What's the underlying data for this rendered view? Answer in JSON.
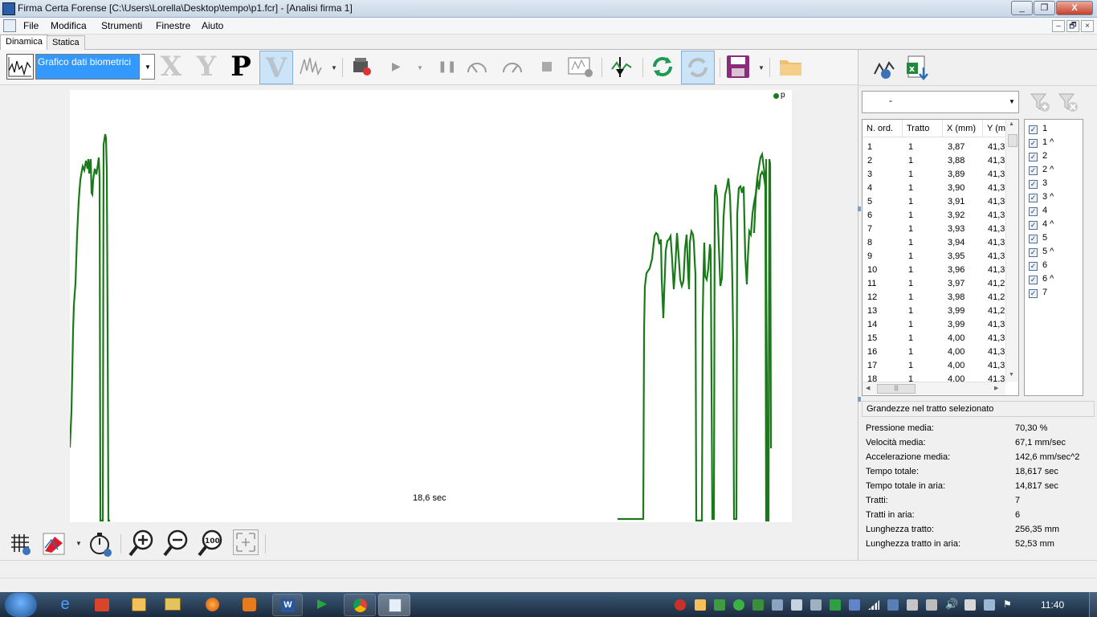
{
  "window": {
    "title": "Firma Certa Forense [C:\\Users\\Lorella\\Desktop\\tempo\\p1.fcr] - [Analisi firma 1]",
    "controls": [
      "_",
      "❐",
      "X"
    ]
  },
  "menu": {
    "items": [
      "File",
      "Modifica",
      "Strumenti",
      "Finestre",
      "Aiuto"
    ],
    "mdi_controls": [
      "–",
      "🗗",
      "×"
    ]
  },
  "tabs": [
    "Dinamica",
    "Statica"
  ],
  "toolbar": {
    "chart_selector_value": "Grafico dati biometrici",
    "letters": [
      "X",
      "Y",
      "P",
      "V"
    ]
  },
  "plot": {
    "legend_label": "p",
    "time_label": "18,6 sec",
    "line_color": "#1a7a1a"
  },
  "filter": {
    "combo_value": "-"
  },
  "grid": {
    "headers": [
      "N. ord.",
      "Tratto",
      "X (mm)",
      "Y (m"
    ],
    "rows": [
      [
        "1",
        "1",
        "3,87",
        "41,3"
      ],
      [
        "2",
        "1",
        "3,88",
        "41,3"
      ],
      [
        "3",
        "1",
        "3,89",
        "41,3"
      ],
      [
        "4",
        "1",
        "3,90",
        "41,3"
      ],
      [
        "5",
        "1",
        "3,91",
        "41,3"
      ],
      [
        "6",
        "1",
        "3,92",
        "41,3"
      ],
      [
        "7",
        "1",
        "3,93",
        "41,3"
      ],
      [
        "8",
        "1",
        "3,94",
        "41,3"
      ],
      [
        "9",
        "1",
        "3,95",
        "41,3"
      ],
      [
        "10",
        "1",
        "3,96",
        "41,3"
      ],
      [
        "11",
        "1",
        "3,97",
        "41,2"
      ],
      [
        "12",
        "1",
        "3,98",
        "41,2"
      ],
      [
        "13",
        "1",
        "3,99",
        "41,2"
      ],
      [
        "14",
        "1",
        "3,99",
        "41,3"
      ],
      [
        "15",
        "1",
        "4,00",
        "41,3"
      ],
      [
        "16",
        "1",
        "4,00",
        "41,3"
      ],
      [
        "17",
        "1",
        "4,00",
        "41,3"
      ],
      [
        "18",
        "1",
        "4,00",
        "41,3"
      ]
    ]
  },
  "strokes": [
    "1",
    "1 ^",
    "2",
    "2 ^",
    "3",
    "3 ^",
    "4",
    "4 ^",
    "5",
    "5 ^",
    "6",
    "6 ^",
    "7"
  ],
  "stats": {
    "header": "Grandezze nel tratto selezionato",
    "items": [
      {
        "label": "Pressione media:",
        "value": "70,30 %"
      },
      {
        "label": "Velocità media:",
        "value": "67,1 mm/sec"
      },
      {
        "label": "Accelerazione media:",
        "value": "142,6 mm/sec^2"
      },
      {
        "label": "Tempo totale:",
        "value": "18,617 sec"
      },
      {
        "label": "Tempo totale in aria:",
        "value": "14,817 sec"
      },
      {
        "label": "Tratti:",
        "value": "7"
      },
      {
        "label": "Tratti in aria:",
        "value": "6"
      },
      {
        "label": "Lunghezza tratto:",
        "value": "256,35 mm"
      },
      {
        "label": "Lunghezza tratto in aria:",
        "value": "52,53 mm"
      }
    ]
  },
  "taskbar": {
    "clock": "11:40"
  }
}
